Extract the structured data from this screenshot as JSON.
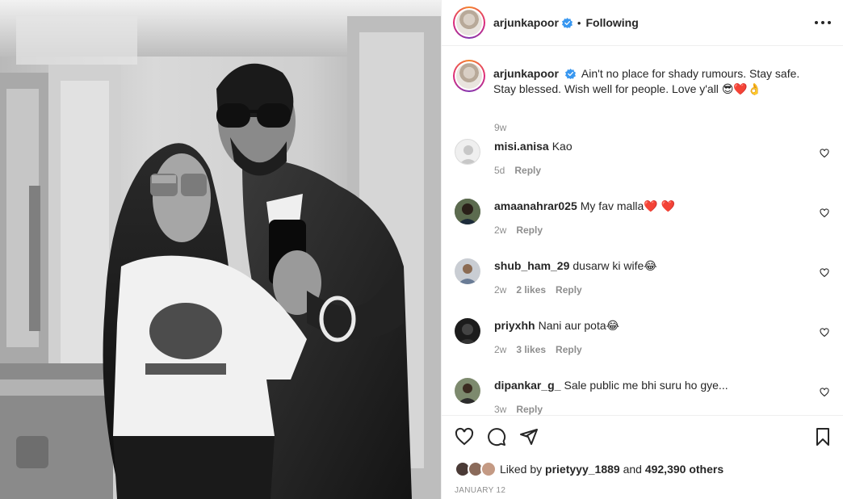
{
  "post": {
    "username": "arjunkapoor",
    "follow_status": "Following",
    "caption_text": "Ain't no place for shady rumours. Stay safe. Stay blessed. Wish well for people. Love y'all",
    "caption_emojis": "😎❤️👌",
    "caption_time": "9w"
  },
  "comments": [
    {
      "username": "misi.anisa",
      "text": "Kao",
      "time": "5d",
      "likes": "",
      "reply": "Reply"
    },
    {
      "username": "amaanahrar025",
      "text": "My fav malla",
      "emoji": "❤️ ❤️",
      "time": "2w",
      "likes": "",
      "reply": "Reply"
    },
    {
      "username": "shub_ham_29",
      "text": "dusarw ki wife",
      "emoji": "😂",
      "time": "2w",
      "likes": "2 likes",
      "reply": "Reply"
    },
    {
      "username": "priyxhh",
      "text": "Nani aur pota",
      "emoji": "😂",
      "time": "2w",
      "likes": "3 likes",
      "reply": "Reply"
    },
    {
      "username": "dipankar_g_",
      "text": "Sale public me bhi suru ho gye...",
      "time": "3w",
      "likes": "",
      "reply": "Reply"
    }
  ],
  "footer": {
    "liked_by_prefix": "Liked by",
    "liked_by_user": "prietyyy_1889",
    "and": "and",
    "others_count": "492,390 others",
    "date": "JANUARY 12"
  },
  "colors": {
    "text": "#262626",
    "secondary": "#8e8e8e",
    "verified": "#3897f0",
    "heart": "#e0162b",
    "border": "#efefef"
  },
  "icons": [
    "verified-badge-icon",
    "more-options-icon",
    "heart-icon",
    "comment-icon",
    "share-icon",
    "bookmark-icon"
  ]
}
